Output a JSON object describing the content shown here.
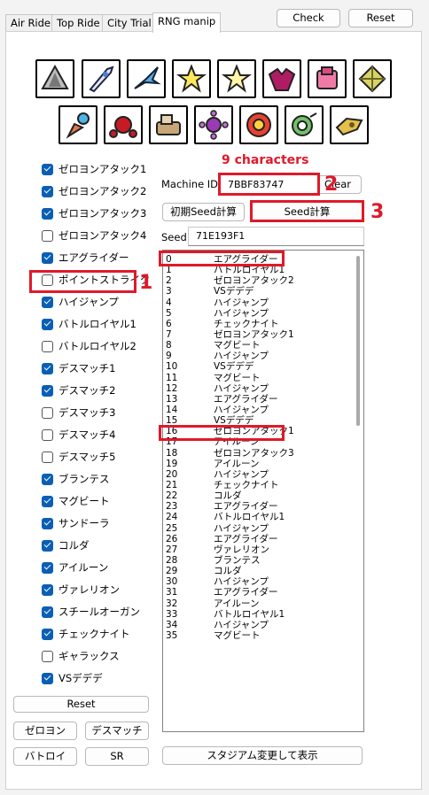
{
  "tabs": [
    "Air Ride",
    "Top Ride",
    "City Trial",
    "RNG manip"
  ],
  "header_buttons": {
    "check": "Check",
    "reset": "Reset"
  },
  "machine_icons": [
    "wagon-star-icon",
    "rocket-star-icon",
    "winged-star-icon",
    "warp-star-icon",
    "compact-star-icon",
    "wheelie-bike-icon",
    "slick-star-icon",
    "bulk-star-icon",
    "swerve-star-icon",
    "turbo-star-icon",
    "rex-wheelie-icon",
    "formula-star-icon",
    "hydra-icon",
    "wheelie-scooter-icon",
    "jet-star-icon"
  ],
  "checkboxes": [
    {
      "label": "ゼロヨンアタック1",
      "checked": true
    },
    {
      "label": "ゼロヨンアタック2",
      "checked": true
    },
    {
      "label": "ゼロヨンアタック3",
      "checked": true
    },
    {
      "label": "ゼロヨンアタック4",
      "checked": false
    },
    {
      "label": "エアグライダー",
      "checked": true
    },
    {
      "label": "ポイントストライク",
      "checked": false
    },
    {
      "label": "ハイジャンプ",
      "checked": true
    },
    {
      "label": "バトルロイヤル1",
      "checked": true
    },
    {
      "label": "バトルロイヤル2",
      "checked": false
    },
    {
      "label": "デスマッチ1",
      "checked": true
    },
    {
      "label": "デスマッチ2",
      "checked": true
    },
    {
      "label": "デスマッチ3",
      "checked": false
    },
    {
      "label": "デスマッチ4",
      "checked": false
    },
    {
      "label": "デスマッチ5",
      "checked": false
    },
    {
      "label": "ブランテス",
      "checked": true
    },
    {
      "label": "マグビート",
      "checked": true
    },
    {
      "label": "サンドーラ",
      "checked": true
    },
    {
      "label": "コルダ",
      "checked": true
    },
    {
      "label": "アイルーン",
      "checked": true
    },
    {
      "label": "ヴァレリオン",
      "checked": true
    },
    {
      "label": "スチールオーガン",
      "checked": true
    },
    {
      "label": "チェックナイト",
      "checked": true
    },
    {
      "label": "ギャラックス",
      "checked": false
    },
    {
      "label": "VSデデデ",
      "checked": true
    }
  ],
  "left_buttons": {
    "reset": "Reset",
    "zeroyon": "ゼロヨン",
    "deathmatch": "デスマッチ",
    "battle": "バトロイ",
    "sr": "SR"
  },
  "annotations": {
    "chars_note": "9 characters",
    "marker1": "1",
    "marker2": "2",
    "marker3": "3"
  },
  "machine_id": {
    "label": "Machine ID",
    "value": "7BBF83747",
    "clear": "Clear"
  },
  "seed_buttons": {
    "initial": "初期Seed計算",
    "calc": "Seed計算"
  },
  "seed": {
    "label": "Seed",
    "value": "71E193F1"
  },
  "list": [
    {
      "n": "0",
      "name": "エアグライダー"
    },
    {
      "n": "1",
      "name": "バトルロイヤル1"
    },
    {
      "n": "2",
      "name": "ゼロヨンアタック2"
    },
    {
      "n": "3",
      "name": "VSデデデ"
    },
    {
      "n": "4",
      "name": "ハイジャンプ"
    },
    {
      "n": "5",
      "name": "ハイジャンプ"
    },
    {
      "n": "6",
      "name": "チェックナイト"
    },
    {
      "n": "7",
      "name": "ゼロヨンアタック1"
    },
    {
      "n": "8",
      "name": "マグビート"
    },
    {
      "n": "9",
      "name": "ハイジャンプ"
    },
    {
      "n": "10",
      "name": "VSデデデ"
    },
    {
      "n": "11",
      "name": "マグビート"
    },
    {
      "n": "12",
      "name": "ハイジャンプ"
    },
    {
      "n": "13",
      "name": "エアグライダー"
    },
    {
      "n": "14",
      "name": "ハイジャンプ"
    },
    {
      "n": "15",
      "name": "VSデデデ"
    },
    {
      "n": "16",
      "name": "ゼロヨンアタック1"
    },
    {
      "n": "17",
      "name": "アイルーン"
    },
    {
      "n": "18",
      "name": "ゼロヨンアタック3"
    },
    {
      "n": "19",
      "name": "アイルーン"
    },
    {
      "n": "20",
      "name": "ハイジャンプ"
    },
    {
      "n": "21",
      "name": "チェックナイト"
    },
    {
      "n": "22",
      "name": "コルダ"
    },
    {
      "n": "23",
      "name": "エアグライダー"
    },
    {
      "n": "24",
      "name": "バトルロイヤル1"
    },
    {
      "n": "25",
      "name": "ハイジャンプ"
    },
    {
      "n": "26",
      "name": "エアグライダー"
    },
    {
      "n": "27",
      "name": "ヴァレリオン"
    },
    {
      "n": "28",
      "name": "ブランテス"
    },
    {
      "n": "29",
      "name": "コルダ"
    },
    {
      "n": "30",
      "name": "ハイジャンプ"
    },
    {
      "n": "31",
      "name": "エアグライダー"
    },
    {
      "n": "32",
      "name": "アイルーン"
    },
    {
      "n": "33",
      "name": "バトルロイヤル1"
    },
    {
      "n": "34",
      "name": "ハイジャンプ"
    },
    {
      "n": "35",
      "name": "マグビート"
    }
  ],
  "stadium_button": "スタジアム変更して表示",
  "colors": {
    "accent": "#0a5fb4",
    "annotation": "#e0192a"
  }
}
